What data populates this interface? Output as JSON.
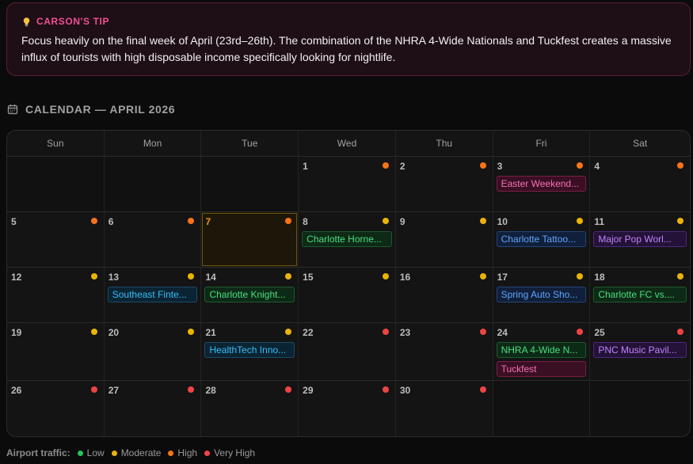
{
  "tip": {
    "title": "CARSON'S TIP",
    "body": "Focus heavily on the final week of April (23rd–26th). The combination of the NHRA 4-Wide Nationals and Tuckfest creates a massive influx of tourists with high disposable income specifically looking for nightlife."
  },
  "calendar": {
    "title": "CALENDAR — APRIL 2026",
    "today": 7,
    "days_of_week": [
      "Sun",
      "Mon",
      "Tue",
      "Wed",
      "Thu",
      "Fri",
      "Sat"
    ],
    "weeks": [
      {
        "height": 70,
        "days": [
          {
            "day": null
          },
          {
            "day": null
          },
          {
            "day": null
          },
          {
            "day": "1",
            "traffic": "high",
            "events": []
          },
          {
            "day": "2",
            "traffic": "high",
            "events": []
          },
          {
            "day": "3",
            "traffic": "high",
            "events": [
              {
                "label": "Easter Weekend...",
                "color": "pink"
              }
            ]
          },
          {
            "day": "4",
            "traffic": "high",
            "events": []
          }
        ]
      },
      {
        "height": 70,
        "days": [
          {
            "day": "5",
            "traffic": "high",
            "events": []
          },
          {
            "day": "6",
            "traffic": "high",
            "events": []
          },
          {
            "day": "7",
            "traffic": "high",
            "events": []
          },
          {
            "day": "8",
            "traffic": "moderate",
            "events": [
              {
                "label": "Charlotte Horne...",
                "color": "green"
              }
            ]
          },
          {
            "day": "9",
            "traffic": "moderate",
            "events": []
          },
          {
            "day": "10",
            "traffic": "moderate",
            "events": [
              {
                "label": "Charlotte Tattoo...",
                "color": "blue"
              }
            ]
          },
          {
            "day": "11",
            "traffic": "moderate",
            "events": [
              {
                "label": "Major Pop Worl...",
                "color": "purple"
              }
            ]
          }
        ]
      },
      {
        "height": 70,
        "days": [
          {
            "day": "12",
            "traffic": "moderate",
            "events": []
          },
          {
            "day": "13",
            "traffic": "moderate",
            "events": [
              {
                "label": "Southeast Finte...",
                "color": "cyan"
              }
            ]
          },
          {
            "day": "14",
            "traffic": "moderate",
            "events": [
              {
                "label": "Charlotte Knight...",
                "color": "green"
              }
            ]
          },
          {
            "day": "15",
            "traffic": "moderate",
            "events": []
          },
          {
            "day": "16",
            "traffic": "moderate",
            "events": []
          },
          {
            "day": "17",
            "traffic": "moderate",
            "events": [
              {
                "label": "Spring Auto Sho...",
                "color": "blue"
              }
            ]
          },
          {
            "day": "18",
            "traffic": "moderate",
            "events": [
              {
                "label": "Charlotte FC vs....",
                "color": "green"
              }
            ]
          }
        ]
      },
      {
        "height": 73,
        "days": [
          {
            "day": "19",
            "traffic": "moderate",
            "events": []
          },
          {
            "day": "20",
            "traffic": "moderate",
            "events": []
          },
          {
            "day": "21",
            "traffic": "moderate",
            "events": [
              {
                "label": "HealthTech Inno...",
                "color": "cyan"
              }
            ]
          },
          {
            "day": "22",
            "traffic": "very_high",
            "events": []
          },
          {
            "day": "23",
            "traffic": "very_high",
            "events": []
          },
          {
            "day": "24",
            "traffic": "very_high",
            "events": [
              {
                "label": "NHRA 4-Wide N...",
                "color": "green"
              },
              {
                "label": "Tuckfest",
                "color": "pink"
              }
            ]
          },
          {
            "day": "25",
            "traffic": "very_high",
            "events": [
              {
                "label": "PNC Music Pavil...",
                "color": "purple"
              }
            ]
          }
        ]
      },
      {
        "height": 70,
        "days": [
          {
            "day": "26",
            "traffic": "very_high",
            "events": []
          },
          {
            "day": "27",
            "traffic": "very_high",
            "events": []
          },
          {
            "day": "28",
            "traffic": "very_high",
            "events": []
          },
          {
            "day": "29",
            "traffic": "very_high",
            "events": []
          },
          {
            "day": "30",
            "traffic": "very_high",
            "events": []
          },
          {
            "day": null
          },
          {
            "day": null
          }
        ]
      }
    ]
  },
  "legend": {
    "title": "Airport traffic:",
    "items": [
      {
        "key": "low",
        "label": "Low"
      },
      {
        "key": "moderate",
        "label": "Moderate"
      },
      {
        "key": "high",
        "label": "High"
      },
      {
        "key": "very_high",
        "label": "Very High"
      }
    ]
  },
  "colors": {
    "traffic": {
      "low": "#22c55e",
      "moderate": "#eab308",
      "high": "#f97316",
      "very_high": "#ef4444"
    },
    "events": {
      "pink": {
        "text": "#f472b6",
        "bg": "#3a0f23",
        "border": "#7a1e44"
      },
      "green": {
        "text": "#4ade80",
        "bg": "#0d2a16",
        "border": "#1c5a30"
      },
      "blue": {
        "text": "#60a5fa",
        "bg": "#101f3a",
        "border": "#23457a"
      },
      "purple": {
        "text": "#c084fc",
        "bg": "#241238",
        "border": "#4c2880"
      },
      "cyan": {
        "text": "#38bdf8",
        "bg": "#0b2433",
        "border": "#1b4a66"
      }
    }
  }
}
